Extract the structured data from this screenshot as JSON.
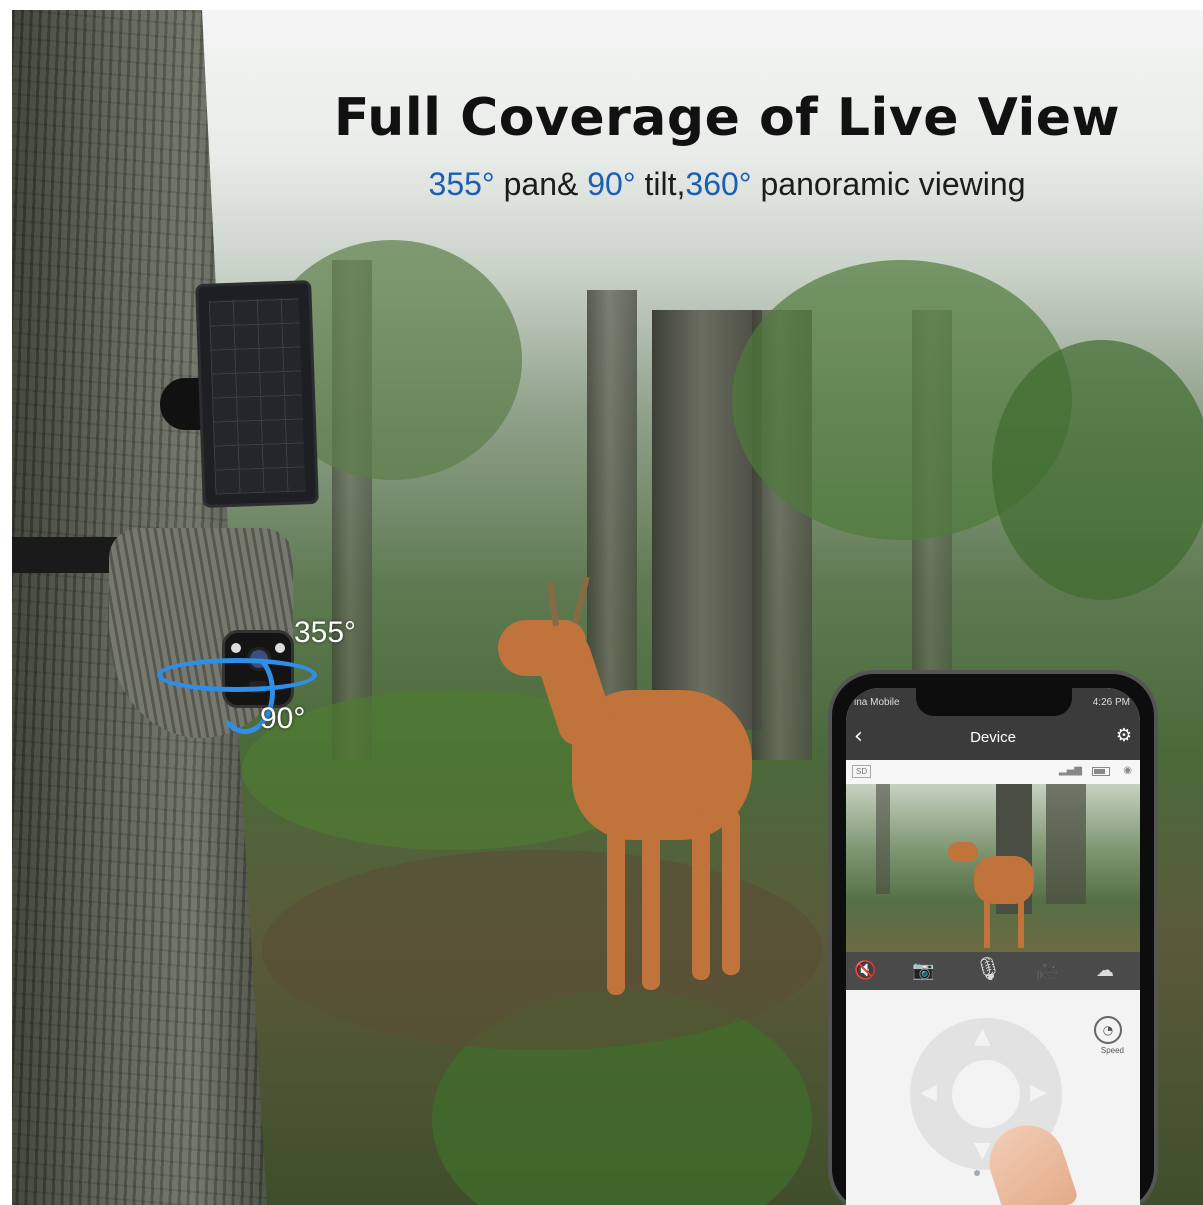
{
  "headline": {
    "title": "Full Coverage of Live View",
    "subtitle_parts": {
      "pan_angle": "355°",
      "pan_text": " pan& ",
      "tilt_angle": "90°",
      "tilt_text": " tilt,",
      "pano_angle": "360°",
      "pano_text": " panoramic viewing"
    }
  },
  "camera": {
    "pan_label": "355°",
    "tilt_label": "90°"
  },
  "phone": {
    "status": {
      "carrier": "ina Mobile",
      "time": "4:26 PM"
    },
    "header": {
      "title": "Device"
    },
    "info_bar": {
      "sd_label": "SD"
    },
    "controls": {
      "mute": "🔇",
      "snapshot": "📷",
      "mic": "🎙",
      "record": "🎥",
      "more": "☁"
    },
    "ptz": {
      "speed_label": "Speed"
    }
  },
  "colors": {
    "accent_blue": "#1a5fb4",
    "ring_blue": "#2f8ee8"
  }
}
